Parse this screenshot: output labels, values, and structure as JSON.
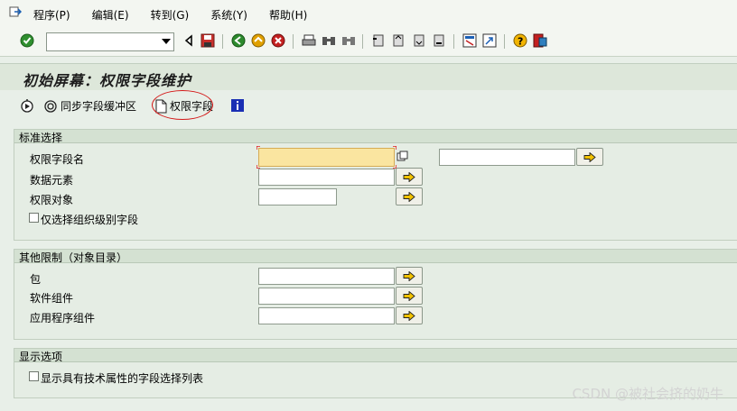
{
  "menu": [
    "程序(P)",
    "编辑(E)",
    "转到(G)",
    "系统(Y)",
    "帮助(H)"
  ],
  "title": "初始屏幕：权限字段维护",
  "app_toolbar": {
    "sync_label": "同步字段缓冲区",
    "field_label": "权限字段"
  },
  "group1": {
    "header": "标准选择",
    "fields": [
      "权限字段名",
      "数据元素",
      "权限对象"
    ],
    "checkbox": "仅选择组织级别字段"
  },
  "group2": {
    "header": "其他限制（对象目录）",
    "fields": [
      "包",
      "软件组件",
      "应用程序组件"
    ]
  },
  "group3": {
    "header": "显示选项",
    "checkbox": "显示具有技术属性的字段选择列表"
  },
  "watermark": "CSDN @被社会挤的奶牛",
  "icons": {
    "exit": "exit-icon",
    "enter": "enter-icon",
    "save": "save-icon",
    "back": "back-icon",
    "exit_nav": "exit-nav-icon",
    "cancel": "cancel-icon",
    "print": "print-icon",
    "find": "find-icon",
    "find_next": "find-next-icon",
    "first_page": "first-page-icon",
    "prev_page": "prev-page-icon",
    "next_page": "next-page-icon",
    "last_page": "last-page-icon",
    "new_session": "new-session-icon",
    "shortcut": "shortcut-icon",
    "help": "help-icon",
    "layout": "layout-icon",
    "info": "info-icon"
  },
  "colors": {
    "focus_field": "#fae5a0",
    "highlight_circle": "#d41818",
    "background": "#e8efe8"
  }
}
